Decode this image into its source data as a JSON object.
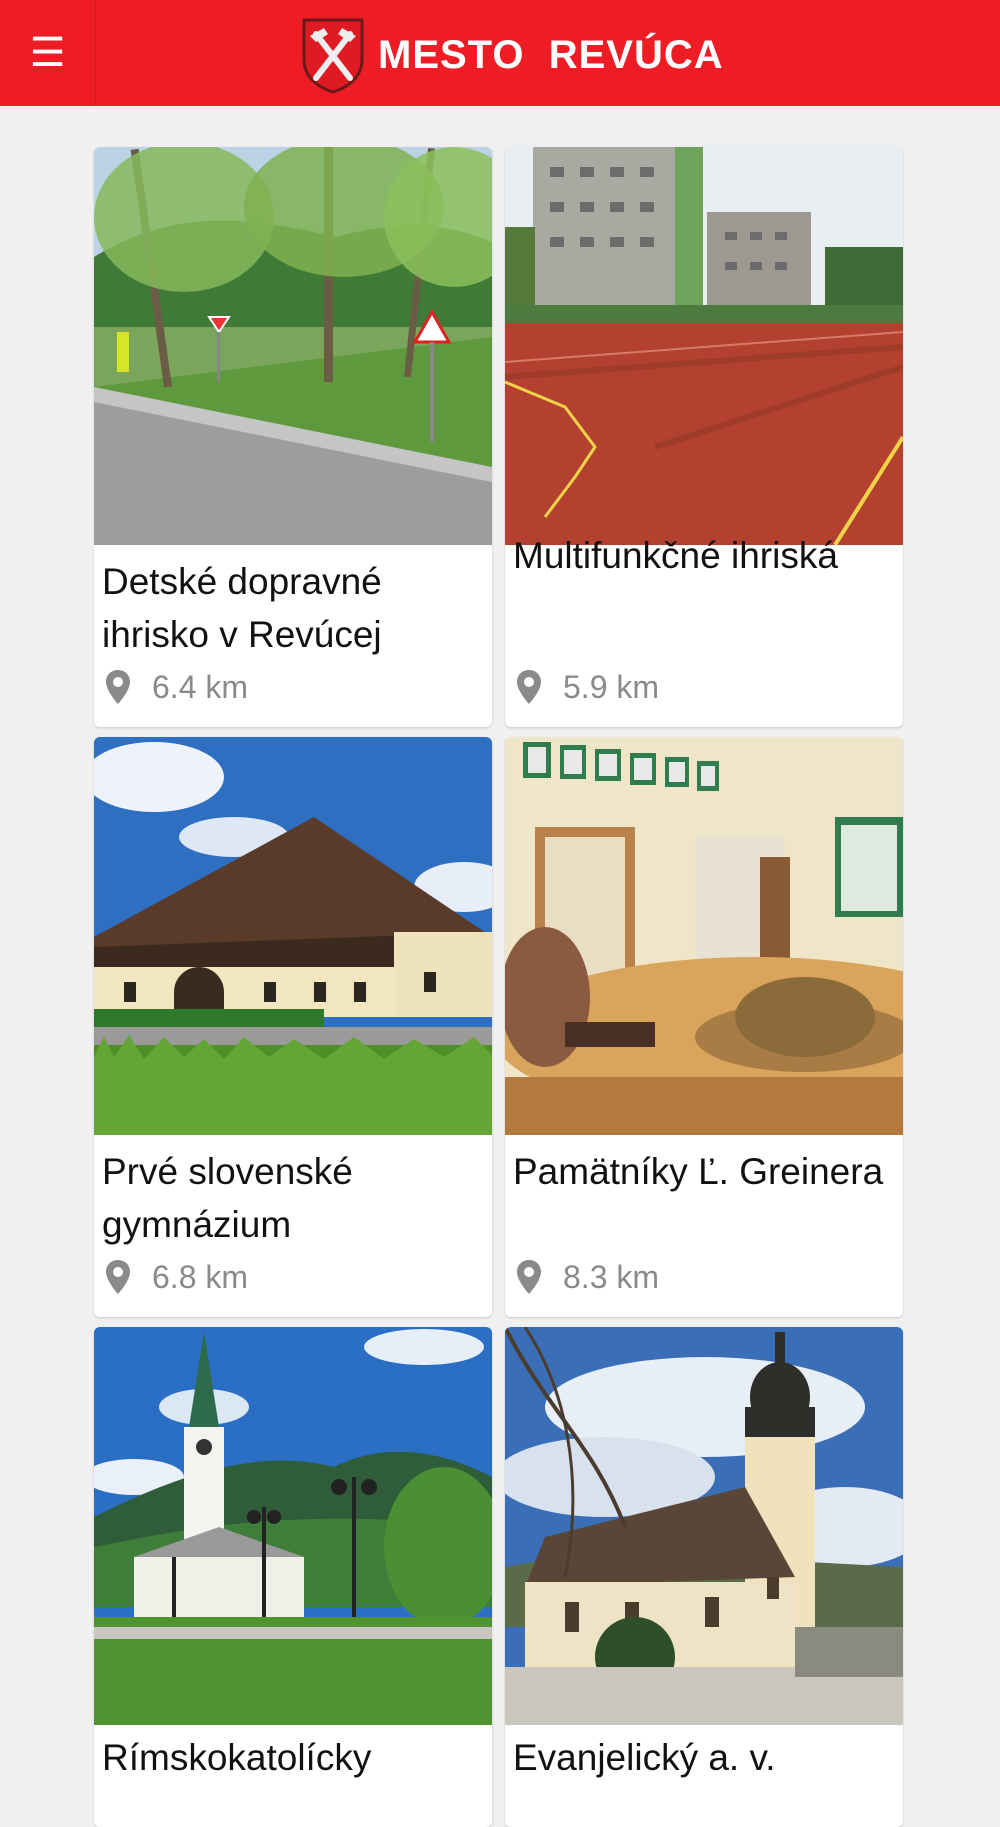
{
  "app": {
    "title": "MESTO  REVÚCA",
    "menu_icon": "hamburger-menu-icon",
    "accent_color": "#ee1c25"
  },
  "cards": [
    {
      "title": "Detské dopravné ihrisko v Revúcej",
      "distance": "6.4 km"
    },
    {
      "title": "Multifunkčné ihriská",
      "distance": "5.9 km"
    },
    {
      "title": "Prvé slovenské gymnázium",
      "distance": "6.8 km"
    },
    {
      "title": "Pamätníky Ľ. Greinera",
      "distance": "8.3 km"
    },
    {
      "title": "Rímskokatolícky",
      "distance": ""
    },
    {
      "title": "Evanjelický a. v.",
      "distance": ""
    }
  ]
}
